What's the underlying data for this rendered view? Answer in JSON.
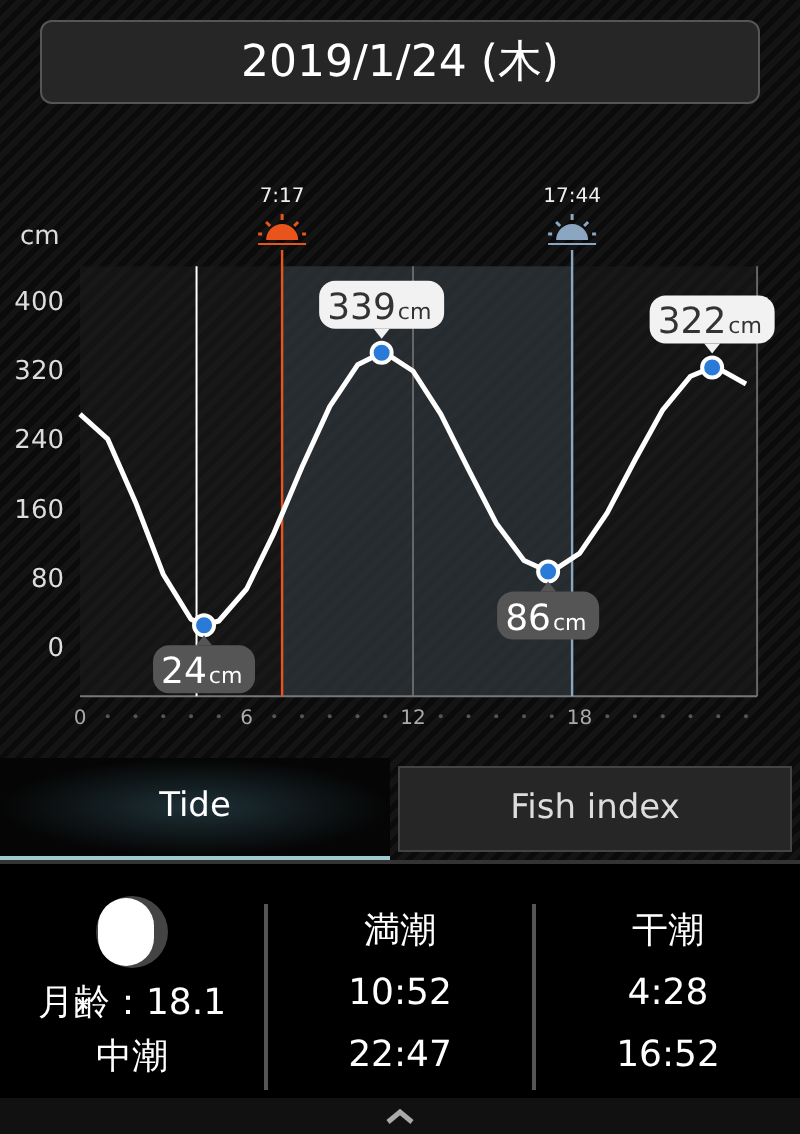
{
  "date_button": "2019/1/24 (木)",
  "chart": {
    "chart_data": {
      "type": "line",
      "ylabel": "cm",
      "xlim": [
        0,
        24.4
      ],
      "ylim": [
        -58,
        439
      ],
      "xticks": [
        0,
        6,
        12,
        18
      ],
      "yticks": [
        0,
        80,
        160,
        240,
        320,
        400
      ],
      "x": [
        0,
        1,
        2,
        3,
        4,
        4.47,
        5,
        6,
        7,
        8,
        9,
        10,
        10.87,
        11,
        12,
        13,
        14,
        15,
        16,
        16.87,
        17,
        18,
        19,
        20,
        21,
        22,
        22.78,
        23,
        24
      ],
      "series": [
        {
          "color": "#ffffff",
          "values": [
            268,
            239,
            166,
            83,
            31,
            24,
            29,
            66,
            131,
            207,
            277,
            325,
            339,
            339,
            318,
            268,
            204,
            142,
            99,
            86,
            86,
            107,
            154,
            215,
            273,
            312,
            322,
            321,
            303
          ]
        }
      ],
      "ref_lines": [
        {
          "axis": "x",
          "value": 7.283,
          "color": "#e8541c"
        },
        {
          "axis": "x",
          "value": 17.7333,
          "color": "#8aa6c0"
        },
        {
          "axis": "x",
          "value": 4.2,
          "color": "#ffffff"
        }
      ],
      "bands": [
        {
          "axis": "x",
          "from": 7.283,
          "to": 17.7333,
          "color": "#3a4750"
        }
      ],
      "annotations": [
        {
          "text": "24cm",
          "x": 4.47,
          "y": 24
        },
        {
          "text": "339cm",
          "x": 10.87,
          "y": 339
        },
        {
          "text": "86cm",
          "x": 16.87,
          "y": 86
        },
        {
          "text": "322cm",
          "x": 22.78,
          "y": 322
        }
      ]
    },
    "sun_times": [
      "7:17",
      "17:44"
    ]
  },
  "tabs": [
    {
      "label": "Tide",
      "selected": true
    },
    {
      "label": "Fish index",
      "selected": false
    }
  ],
  "moon": {
    "age": "月齢：18.1",
    "tide_name": "中潮"
  },
  "tide_columns": [
    {
      "title": "満潮",
      "times": [
        "10:52",
        "22:47"
      ]
    },
    {
      "title": "干潮",
      "times": [
        "4:28",
        "16:52"
      ]
    }
  ]
}
